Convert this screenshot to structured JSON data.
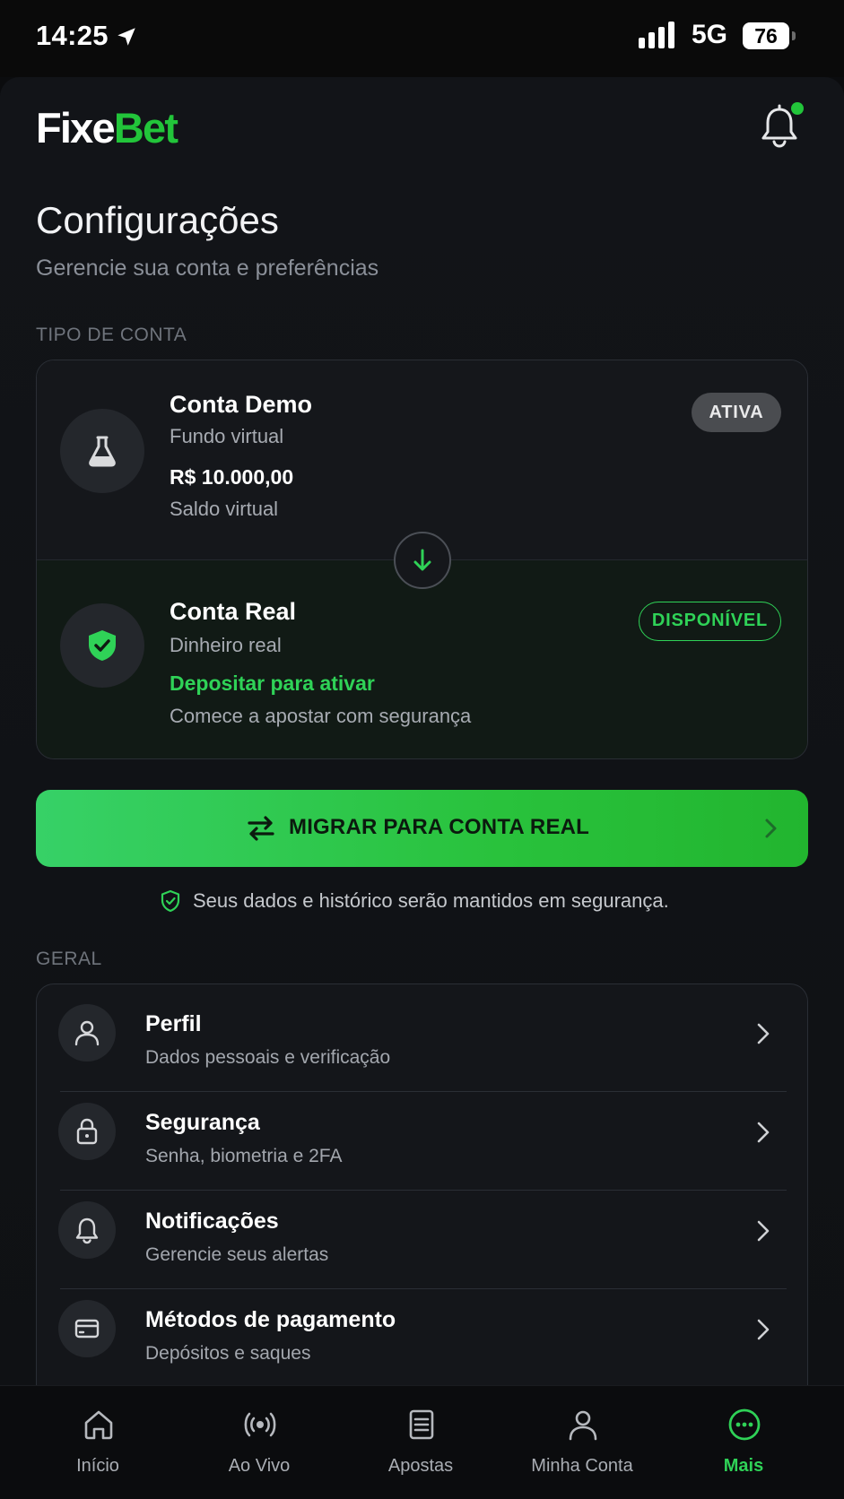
{
  "status_bar": {
    "time": "14:25",
    "network": "5G",
    "battery": "76"
  },
  "header": {
    "logo_primary": "Fixe",
    "logo_accent": "Bet",
    "has_notification_dot": true
  },
  "page": {
    "title": "Configurações",
    "subtitle": "Gerencie sua conta e preferências"
  },
  "account_section": {
    "label": "TIPO DE CONTA",
    "demo": {
      "title": "Conta Demo",
      "subtitle": "Fundo virtual",
      "balance": "R$ 10.000,00",
      "balance_label": "Saldo virtual",
      "badge": "ATIVA",
      "icon": "flask-icon"
    },
    "real": {
      "title": "Conta Real",
      "subtitle": "Dinheiro real",
      "cta": "Depositar para ativar",
      "description": "Comece a apostar com segurança",
      "badge": "DISPONÍVEL",
      "icon": "shield-check-icon"
    }
  },
  "migrate": {
    "label": "MIGRAR PARA CONTA REAL",
    "note": "Seus dados e histórico serão mantidos em segurança."
  },
  "general_section": {
    "label": "GERAL",
    "items": [
      {
        "title": "Perfil",
        "subtitle": "Dados pessoais e verificação",
        "icon": "user-icon"
      },
      {
        "title": "Segurança",
        "subtitle": "Senha, biometria e 2FA",
        "icon": "lock-icon"
      },
      {
        "title": "Notificações",
        "subtitle": "Gerencie seus alertas",
        "icon": "bell-icon"
      },
      {
        "title": "Métodos de pagamento",
        "subtitle": "Depósitos e saques",
        "icon": "card-icon"
      }
    ]
  },
  "bottom_nav": {
    "items": [
      {
        "label": "Início",
        "icon": "home-icon"
      },
      {
        "label": "Ao Vivo",
        "icon": "live-icon"
      },
      {
        "label": "Apostas",
        "icon": "bets-icon"
      },
      {
        "label": "Minha Conta",
        "icon": "user-icon"
      },
      {
        "label": "Mais",
        "icon": "more-icon"
      }
    ],
    "active_index": 4
  },
  "colors": {
    "accent": "#22c53a",
    "accent_light": "#2fd257",
    "background": "#0b0c0e",
    "card": "#14161a",
    "muted_text": "#8a8f98"
  }
}
